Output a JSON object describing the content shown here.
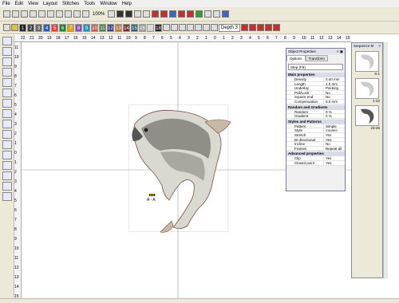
{
  "menu": [
    "File",
    "Edit",
    "View",
    "Layout",
    "Stitches",
    "Tools",
    "Window",
    "Help"
  ],
  "toolbar1": {
    "zoom": "100%"
  },
  "toolbar2": {
    "numbers": [
      "1",
      "2",
      "3",
      "4",
      "5",
      "6",
      "7",
      "8",
      "9",
      "10",
      "11",
      "12",
      "13",
      "14",
      "15",
      "16",
      "17",
      "18"
    ],
    "depth": "Depth 3"
  },
  "hruler": [
    "22",
    "21",
    "20",
    "19",
    "18",
    "17",
    "16",
    "15",
    "14",
    "13",
    "12",
    "11",
    "10",
    "9",
    "8",
    "7",
    "6",
    "5",
    "4",
    "3",
    "2",
    "1",
    "0",
    "1",
    "2",
    "3",
    "4",
    "5",
    "6",
    "7",
    "8",
    "9",
    "10",
    "11",
    "12",
    "13",
    "14",
    "15"
  ],
  "vruler": [
    "11",
    "10",
    "9",
    "8",
    "7",
    "6",
    "5",
    "4",
    "3",
    "2",
    "1",
    "0",
    "1",
    "2",
    "3",
    "4",
    "5",
    "6",
    "7",
    "8",
    "9",
    "10",
    "11",
    "12",
    "13",
    "14",
    "15"
  ],
  "anchor_label": "A - A",
  "object_properties": {
    "title": "Object Properties",
    "tabs": [
      "Options",
      "Transform"
    ],
    "stitch_type": "Step (F5)",
    "sections": [
      {
        "name": "Main properties",
        "rows": [
          {
            "k": "Density",
            "v": "0.40 mm"
          },
          {
            "k": "Length",
            "v": "4.0 mm"
          },
          {
            "k": "Underlay",
            "v": "Packing"
          },
          {
            "k": "Pull/Lock",
            "v": "No"
          },
          {
            "k": "Square end",
            "v": "No"
          },
          {
            "k": "Compensation",
            "v": "0.0 mm"
          }
        ]
      },
      {
        "name": "Random and Gradients",
        "rows": [
          {
            "k": "Random",
            "v": "0 %"
          },
          {
            "k": "Gradient",
            "v": "0 %"
          }
        ]
      },
      {
        "name": "Styles and Patterns",
        "rows": [
          {
            "k": "Pattern",
            "v": "Simple"
          },
          {
            "k": "Style",
            "v": "<none>"
          },
          {
            "k": "Stretch",
            "v": "Yes"
          },
          {
            "k": "Bi-directional",
            "v": "Yes"
          },
          {
            "k": "Incline",
            "v": "No"
          },
          {
            "k": "Frames",
            "v": "Repeat all"
          }
        ]
      },
      {
        "name": "Advanced properties",
        "rows": [
          {
            "k": "Clip",
            "v": "Yes"
          },
          {
            "k": "Closed point",
            "v": "Yes"
          }
        ]
      }
    ]
  },
  "sequence": {
    "title": "Sequence M",
    "items": [
      {
        "cap": "0-1"
      },
      {
        "cap": "1-22"
      },
      {
        "cap": "23-26"
      }
    ]
  }
}
